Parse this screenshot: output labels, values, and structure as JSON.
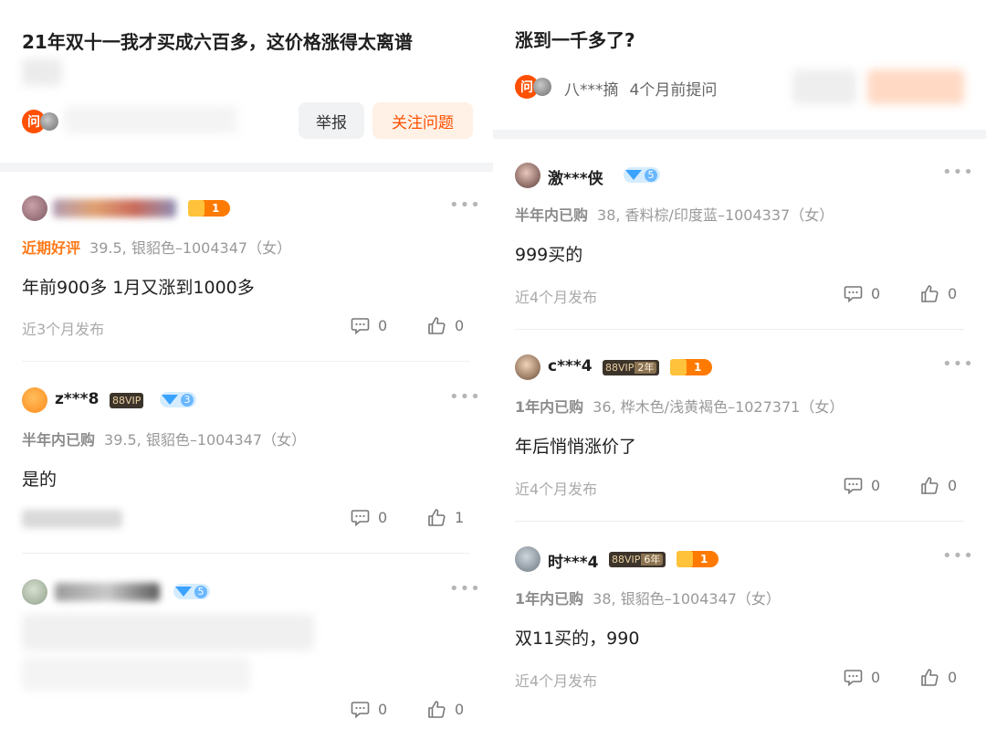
{
  "left": {
    "question_title": "21年双十一我才买成六百多，这价格涨得太离谱",
    "ask_badge": "问",
    "report_button": "举报",
    "follow_button": "关注问题",
    "answers": [
      {
        "tag": "近期好评",
        "purchase": "39.5, 银貂色–1004347（女）",
        "content": "年前900多 1月又涨到1000多",
        "time": "近3个月发布",
        "comments": "0",
        "likes": "0",
        "crown_level": "1"
      },
      {
        "username": "z***8",
        "vip": "88VIP",
        "diamond_level": "3",
        "tag": "半年内已购",
        "purchase": "39.5, 银貂色–1004347（女）",
        "content": "是的",
        "comments": "0",
        "likes": "1"
      },
      {
        "diamond_level": "5",
        "comments": "0",
        "likes": "0"
      }
    ]
  },
  "right": {
    "question_title": "涨到一千多了?",
    "ask_badge": "问",
    "asker_name": "八***摘",
    "asked_time": "4个月前提问",
    "answers": [
      {
        "username": "激***侠",
        "diamond_level": "5",
        "tag": "半年内已购",
        "purchase": "38, 香料棕/印度蓝–1004337（女）",
        "content": "999买的",
        "time": "近4个月发布",
        "comments": "0",
        "likes": "0"
      },
      {
        "username": "c***4",
        "vip": "88VIP",
        "vip_years": "2年",
        "crown_level": "1",
        "tag": "1年内已购",
        "purchase": "36, 桦木色/浅黄褐色–1027371（女）",
        "content": "年后悄悄涨价了",
        "time": "近4个月发布",
        "comments": "0",
        "likes": "0"
      },
      {
        "username": "时***4",
        "vip": "88VIP",
        "vip_years": "6年",
        "crown_level": "1",
        "tag": "1年内已购",
        "purchase": "38, 银貂色–1004347（女）",
        "content": "双11买的，990",
        "time": "近4个月发布",
        "comments": "0",
        "likes": "0"
      }
    ]
  },
  "icons": {
    "more": "more-dots-icon",
    "comment": "comment-icon",
    "like": "thumbs-up-icon"
  },
  "colors": {
    "accent": "#ff5000",
    "follow_bg": "#fff1e6",
    "tag_orange": "#ff7a1a",
    "diamond": "#3aa2ff",
    "crown": "#ff7a00"
  }
}
